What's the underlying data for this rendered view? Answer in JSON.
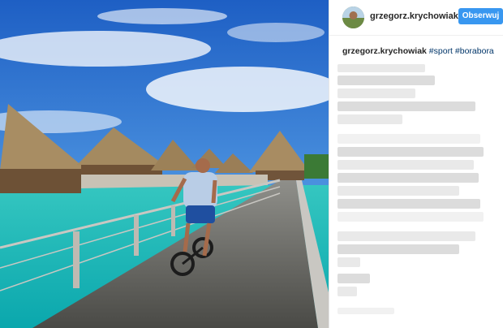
{
  "post": {
    "username": "grzegorz.krychowiak",
    "follow_label": "Obserwuj",
    "caption_user": "grzegorz.krychowiak",
    "hashtags": [
      "#sport",
      "#borabora"
    ]
  },
  "photo": {
    "scene_id": "post-photo"
  },
  "colors": {
    "follow_button": "#3897f0",
    "hashtag": "#003569"
  }
}
